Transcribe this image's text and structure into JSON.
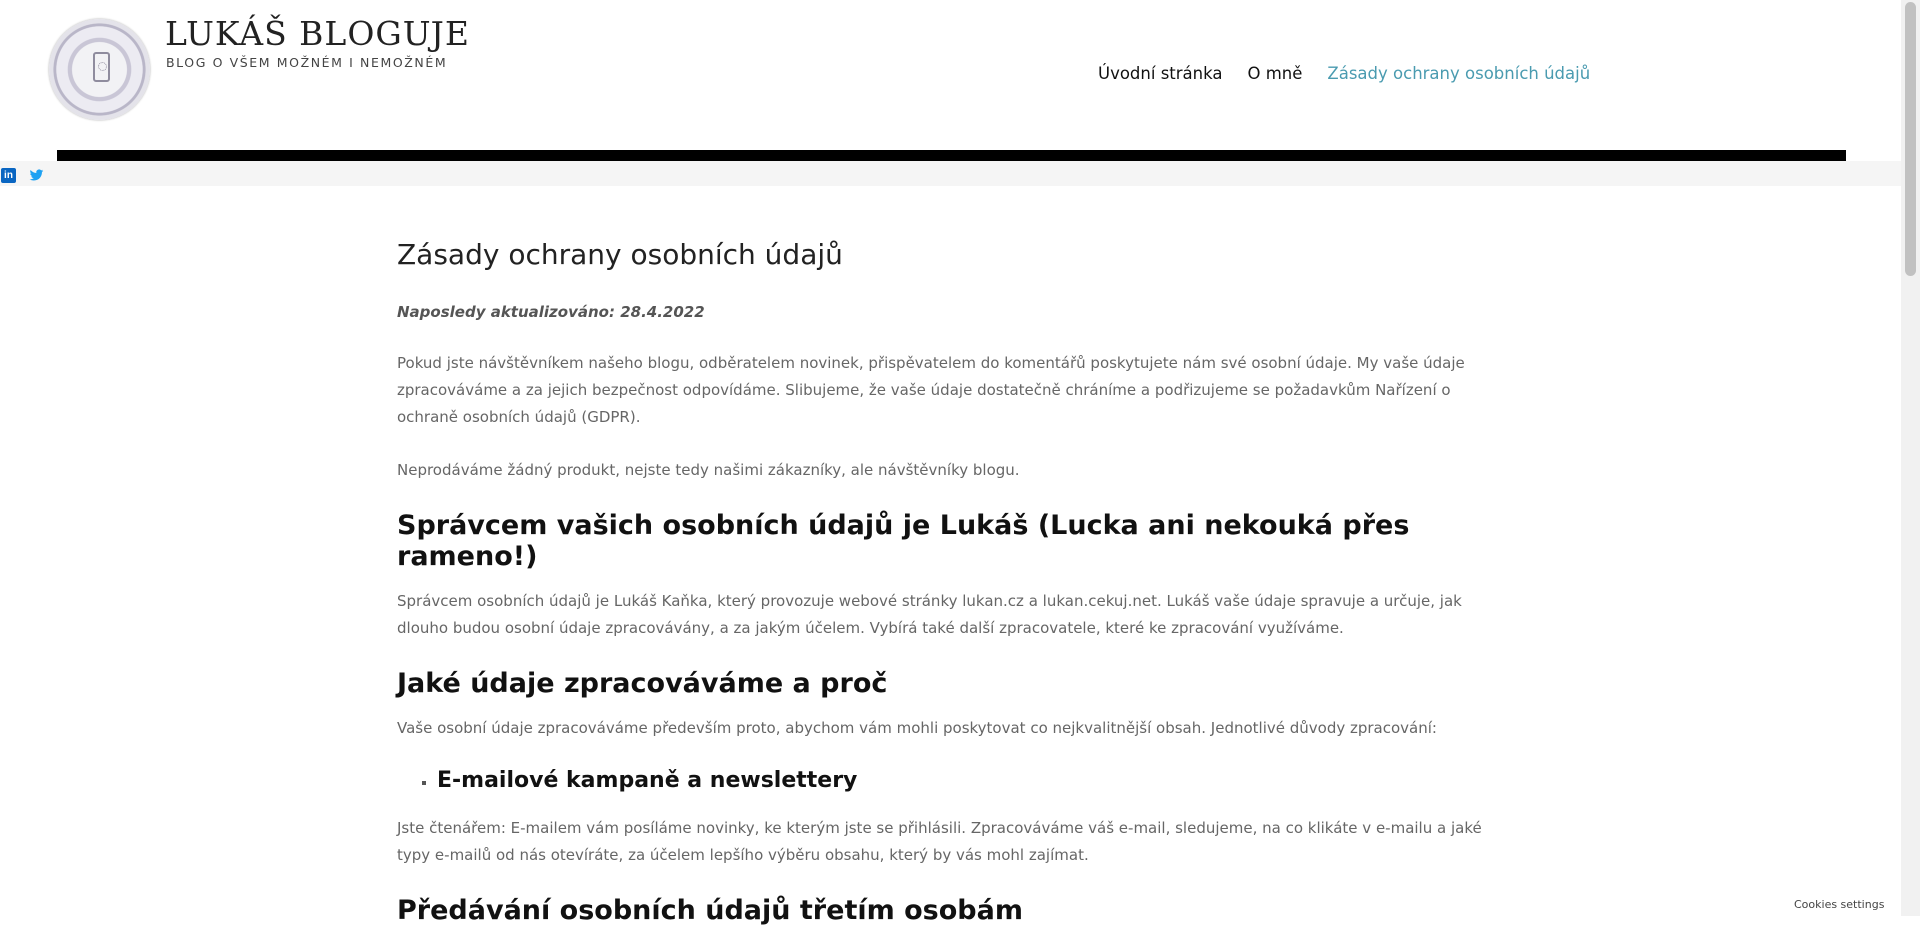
{
  "header": {
    "site_title": "LUKÁŠ BLOGUJE",
    "site_tagline": "BLOG O VŠEM MOŽNÉM I NEMOŽNÉM",
    "nav": [
      {
        "label": "Úvodní stránka"
      },
      {
        "label": "O mně"
      },
      {
        "label": "Zásady ochrany osobních údajů",
        "active": true
      }
    ]
  },
  "social": {
    "linkedin": "in",
    "icons": [
      "linkedin-icon",
      "twitter-icon"
    ],
    "colors": {
      "linkedin": "#0a66c2",
      "twitter": "#1da1f2"
    }
  },
  "content": {
    "page_title": "Zásady ochrany osobních údajů",
    "updated": "Naposledy aktualizováno: 28.4.2022",
    "intro_1": "Pokud jste návštěvníkem našeho blogu, odběratelem novinek, přispěvatelem do komentářů  poskytujete nám své osobní údaje. My vaše údaje zpracováváme a za jejich bezpečnost odpovídáme. Slibujeme, že vaše údaje dostatečně chráníme a podřizujeme se požadavkům Nařízení o ochraně osobních údajů (GDPR).",
    "intro_2": "Neprodáváme žádný produkt, nejste tedy našimi zákazníky, ale návštěvníky blogu.",
    "h_admin": "Správcem vašich osobních údajů je Lukáš (Lucka ani nekouká přes rameno!)",
    "p_admin": "Správcem osobních údajů je Lukáš Kaňka, který provozuje webové stránky lukan.cz a lukan.cekuj.net. Lukáš vaše údaje spravuje a určuje, jak dlouho budou osobní údaje zpracovávány, a za jakým účelem. Vybírá také další zpracovatele, které ke zpracování využíváme.",
    "h_data": "Jaké údaje zpracováváme a proč",
    "p_data": "Vaše osobní údaje zpracováváme především proto, abychom vám mohli poskytovat co nejkvalitnější obsah. Jednotlivé důvody zpracování:",
    "li_email": "E-mailové kampaně a newslettery",
    "p_email": "Jste čtenářem: E-mailem vám posíláme novinky, ke kterým jste se přihlásili. Zpracováváme váš e-mail, sledujeme, na co klikáte v e-mailu a jaké typy e-mailů od nás otevíráte, za účelem lepšího výběru obsahu, který by vás mohl zajímat.",
    "h_third": "Předávání osobních údajů třetím osobám"
  },
  "footer": {
    "cookies": "Cookies settings"
  },
  "colors": {
    "accent": "#4a9bb0",
    "body_text": "#666666",
    "heading": "#111111"
  }
}
